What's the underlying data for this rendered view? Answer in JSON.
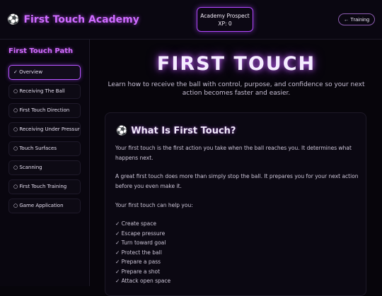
{
  "header": {
    "brand_icon": "soccer-ball-icon",
    "brand_glyph": "⚽",
    "brand_title": "First Touch Academy",
    "rank": "Academy Prospect",
    "xp": "XP: 0",
    "training_button": "← Training"
  },
  "sidebar": {
    "title": "First Touch Path",
    "items": [
      {
        "label": "✓ Overview",
        "active": true
      },
      {
        "label": "○ Receiving The Ball"
      },
      {
        "label": "○ First Touch Direction"
      },
      {
        "label": "○ Receiving Under Pressure"
      },
      {
        "label": "○ Touch Surfaces"
      },
      {
        "label": "○ Scanning"
      },
      {
        "label": "○ First Touch Training"
      },
      {
        "label": "○ Game Application"
      }
    ]
  },
  "main": {
    "hero_title": "FIRST TOUCH",
    "hero_subtitle": "Learn how to receive the ball with control, purpose, and confidence so your next action becomes faster and easier.",
    "card": {
      "icon_glyph": "⚽",
      "heading": "What Is First Touch?",
      "paragraphs": [
        "Your first touch is the first action you take when the ball reaches you. It determines what happens next.",
        "A great first touch does more than simply stop the ball. It prepares you for your next action before you even make it.",
        "Your first touch can help you:"
      ],
      "benefits": [
        "✓ Create space",
        "✓ Escape pressure",
        "✓ Turn toward goal",
        "✓ Protect the ball",
        "✓ Prepare a pass",
        "✓ Prepare a shot",
        "✓ Attack open space"
      ]
    }
  },
  "colors": {
    "accent": "#c45cff",
    "background": "#07050b",
    "panel": "#0b0812"
  }
}
